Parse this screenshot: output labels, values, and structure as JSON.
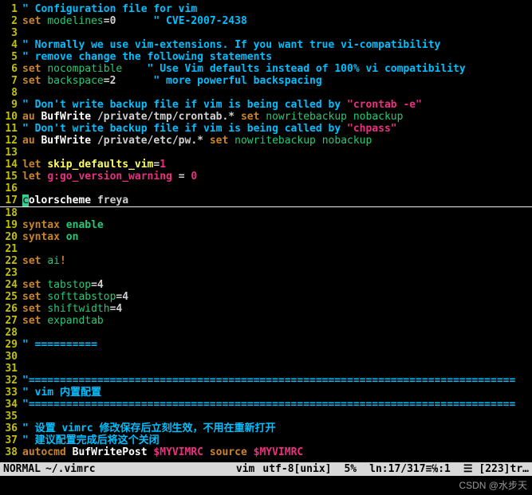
{
  "cursor_line": 17,
  "lines": [
    {
      "n": 1,
      "tokens": [
        [
          "comment",
          "\" Configuration file for vim"
        ]
      ]
    },
    {
      "n": 2,
      "tokens": [
        [
          "keyword",
          "set "
        ],
        [
          "option",
          "modelines"
        ],
        [
          "plain",
          "=0"
        ],
        [
          "plain",
          "      "
        ],
        [
          "comment",
          "\" CVE-2007-2438"
        ]
      ]
    },
    {
      "n": 3,
      "tokens": []
    },
    {
      "n": 4,
      "tokens": [
        [
          "comment",
          "\" Normally we use vim-extensions. If you want true vi-compatibility"
        ]
      ]
    },
    {
      "n": 5,
      "tokens": [
        [
          "comment",
          "\" remove change the following statements"
        ]
      ]
    },
    {
      "n": 6,
      "tokens": [
        [
          "keyword",
          "set "
        ],
        [
          "option",
          "nocompatible"
        ],
        [
          "plain",
          "    "
        ],
        [
          "comment",
          "\" Use Vim defaults instead of 100% vi compatibility"
        ]
      ]
    },
    {
      "n": 7,
      "tokens": [
        [
          "keyword",
          "set "
        ],
        [
          "option",
          "backspace"
        ],
        [
          "plain",
          "=2"
        ],
        [
          "plain",
          "      "
        ],
        [
          "comment",
          "\" more powerful backspacing"
        ]
      ]
    },
    {
      "n": 8,
      "tokens": []
    },
    {
      "n": 9,
      "tokens": [
        [
          "comment",
          "\" Don't write backup file if vim is being called by "
        ],
        [
          "string",
          "\"crontab -e\""
        ]
      ]
    },
    {
      "n": 10,
      "tokens": [
        [
          "keyword",
          "au "
        ],
        [
          "event",
          "BufWrite "
        ],
        [
          "plain",
          "/private/tmp/crontab.* "
        ],
        [
          "keyword",
          "set "
        ],
        [
          "option",
          "nowritebackup nobackup"
        ]
      ]
    },
    {
      "n": 11,
      "tokens": [
        [
          "comment",
          "\" Don't write backup file if vim is being called by "
        ],
        [
          "string",
          "\"chpass\""
        ]
      ]
    },
    {
      "n": 12,
      "tokens": [
        [
          "keyword",
          "au "
        ],
        [
          "event",
          "BufWrite "
        ],
        [
          "plain",
          "/private/etc/pw.* "
        ],
        [
          "keyword",
          "set "
        ],
        [
          "option",
          "nowritebackup nobackup"
        ]
      ]
    },
    {
      "n": 13,
      "tokens": []
    },
    {
      "n": 14,
      "tokens": [
        [
          "keyword",
          "let "
        ],
        [
          "let",
          "skip_defaults_vim"
        ],
        [
          "plain",
          "="
        ],
        [
          "number",
          "1"
        ]
      ]
    },
    {
      "n": 15,
      "tokens": [
        [
          "keyword",
          "let "
        ],
        [
          "identMag",
          "g:go_version_warning "
        ],
        [
          "plain",
          "= "
        ],
        [
          "number",
          "0"
        ]
      ]
    },
    {
      "n": 16,
      "tokens": []
    },
    {
      "n": 17,
      "tokens": [
        [
          "cursor",
          "c"
        ],
        [
          "identifier",
          "olorscheme"
        ],
        [
          "plain",
          " "
        ],
        [
          "plain",
          "freya"
        ]
      ]
    },
    {
      "n": 18,
      "tokens": []
    },
    {
      "n": 19,
      "tokens": [
        [
          "keyword",
          "syntax "
        ],
        [
          "bool",
          "enable"
        ]
      ]
    },
    {
      "n": 20,
      "tokens": [
        [
          "keyword",
          "syntax "
        ],
        [
          "bool",
          "on"
        ]
      ]
    },
    {
      "n": 21,
      "tokens": []
    },
    {
      "n": 22,
      "tokens": [
        [
          "keyword",
          "set "
        ],
        [
          "option",
          "ai"
        ],
        [
          "keyword",
          "!"
        ]
      ]
    },
    {
      "n": 23,
      "tokens": []
    },
    {
      "n": 24,
      "tokens": [
        [
          "keyword",
          "set "
        ],
        [
          "option",
          "tabstop"
        ],
        [
          "plain",
          "=4"
        ]
      ]
    },
    {
      "n": 25,
      "tokens": [
        [
          "keyword",
          "set "
        ],
        [
          "option",
          "softtabstop"
        ],
        [
          "plain",
          "=4"
        ]
      ]
    },
    {
      "n": 26,
      "tokens": [
        [
          "keyword",
          "set "
        ],
        [
          "option",
          "shiftwidth"
        ],
        [
          "plain",
          "=4"
        ]
      ]
    },
    {
      "n": 27,
      "tokens": [
        [
          "keyword",
          "set "
        ],
        [
          "option",
          "expandtab"
        ]
      ]
    },
    {
      "n": 28,
      "tokens": []
    },
    {
      "n": 29,
      "tokens": [
        [
          "comment",
          "\" =========="
        ]
      ]
    },
    {
      "n": 30,
      "tokens": []
    },
    {
      "n": 31,
      "tokens": []
    },
    {
      "n": 32,
      "tokens": [
        [
          "comment",
          "\"=============================================================================="
        ]
      ]
    },
    {
      "n": 33,
      "tokens": [
        [
          "comment",
          "\" vim 内置配置"
        ]
      ]
    },
    {
      "n": 34,
      "tokens": [
        [
          "comment",
          "\"=============================================================================="
        ]
      ]
    },
    {
      "n": 35,
      "tokens": []
    },
    {
      "n": 36,
      "tokens": [
        [
          "comment",
          "\" 设置 vimrc 修改保存后立刻生效，不用在重新打开"
        ]
      ]
    },
    {
      "n": 37,
      "tokens": [
        [
          "comment",
          "\" 建议配置完成后将这个关闭"
        ]
      ]
    },
    {
      "n": 38,
      "tokens": [
        [
          "keyword",
          "autocmd "
        ],
        [
          "event",
          "BufWritePost "
        ],
        [
          "identMag",
          "$MYVIMRC "
        ],
        [
          "keyword",
          "source "
        ],
        [
          "identMag",
          "$MYVIMRC"
        ]
      ]
    }
  ],
  "status": {
    "mode": "NORMAL",
    "file": "~/.vimrc",
    "filetype": "vim",
    "encoding": "utf-8[unix]",
    "percent": "5%",
    "position": "ln:17/317≡℅:1",
    "trailing": "☰  [223]tr…"
  },
  "watermark": "CSDN @水步天"
}
